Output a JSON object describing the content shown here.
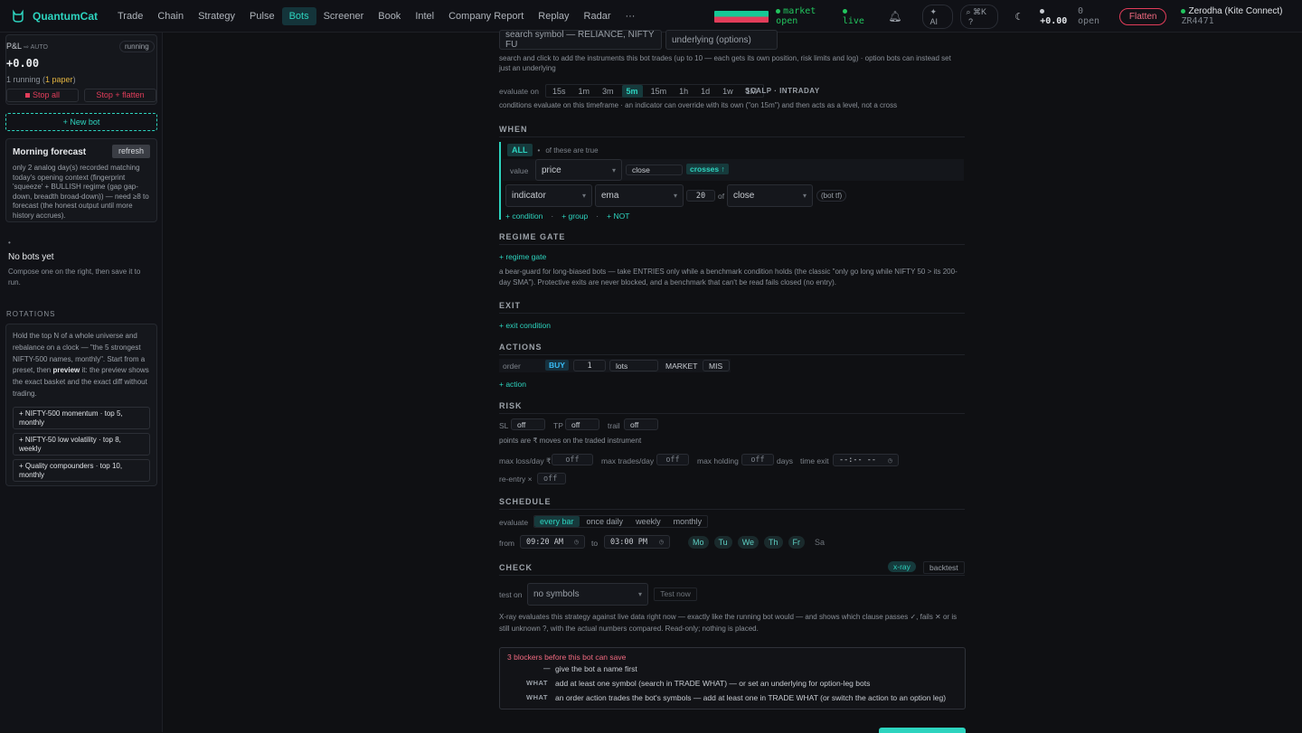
{
  "app": {
    "name": "QuantumCat"
  },
  "nav": [
    "Trade",
    "Chain",
    "Strategy",
    "Pulse",
    "Bots",
    "Screener",
    "Book",
    "Intel",
    "Company Report",
    "Replay",
    "Radar",
    "···"
  ],
  "nav_active": 4,
  "topbar": {
    "market": "market open",
    "live": "live",
    "ai": "AI",
    "kbd": "⌘K",
    "help": "?",
    "pnl": "+0.00",
    "open": "0 open",
    "flatten": "Flatten",
    "broker": "Zerodha (Kite Connect)",
    "account": "ZR4471"
  },
  "sidebar": {
    "pnl_label": "P&L",
    "pnl_sub": "⇨ AUTO",
    "running_badge": "running",
    "pnl_value": "+0.00",
    "running_text": "1 running (",
    "paper_text": "1 paper",
    ")": ")",
    "stop_all": "Stop all",
    "stop_flatten": "Stop + flatten",
    "new_bot": "+ New bot",
    "forecast_title": "Morning forecast",
    "refresh": "refresh",
    "forecast_body": "only 2 analog day(s) recorded matching today's opening context (fingerprint 'squeeze' + BULLISH regime (gap gap-down, breadth broad-down)) — need ≥8 to forecast (the honest output until more history accrues).",
    "bullet": "•",
    "no_bots_title": "No bots yet",
    "no_bots_body": "Compose one on the right, then save it to run.",
    "rotations_label": "ROTATIONS",
    "rotations_body_1": "Hold the top N of a whole universe and rebalance on a clock — \"the 5 strongest NIFTY-500 names, monthly\". Start from a preset, then ",
    "rotations_bold": "preview",
    "rotations_body_2": " it: the preview shows the exact basket and the exact diff without trading.",
    "presets": [
      "+ NIFTY-500 momentum · top 5, monthly",
      "+ NIFTY-50 low volatility · top 8, weekly",
      "+ Quality compounders · top 10, monthly"
    ]
  },
  "main": {
    "symbol_placeholder": "search symbol — RELIANCE, NIFTY FU",
    "underlying_placeholder": "underlying (options)",
    "symbol_help": "search and click to add the instruments this bot trades (up to 10 — each gets its own position, risk limits and log) · option bots can instead set just an underlying",
    "evaluate_on": "evaluate on",
    "timeframes": [
      "15s",
      "1m",
      "3m",
      "5m",
      "15m",
      "1h",
      "1d",
      "1w",
      "1M"
    ],
    "tf_active": 3,
    "scalp": "SCALP · INTRADAY",
    "tf_help": "conditions evaluate on this timeframe · an indicator can override with its own (\"on 15m\") and then acts as a level, not a cross",
    "when": "WHEN",
    "all": "ALL",
    "all_dot": "•",
    "all_text": "of these are true",
    "value": "value",
    "price": "price",
    "close": "close",
    "crosses": "crosses ↑",
    "indicator": "indicator",
    "ema": "ema",
    "period": "20",
    "of": "of",
    "close2": "close",
    "bot_tf": "(bot tf)",
    "add_condition": "+ condition",
    "add_group": "+ group",
    "add_not": "+ NOT",
    "regime": "REGIME GATE",
    "add_regime": "+ regime gate",
    "regime_help": "a bear-guard for long-biased bots — take ENTRIES only while a benchmark condition holds (the classic \"only go long while NIFTY 50 > its 200-day SMA\"). Protective exits are never blocked, and a benchmark that can't be read fails closed (no entry).",
    "exit": "EXIT",
    "add_exit": "+ exit condition",
    "actions": "ACTIONS",
    "order": "order",
    "buy": "BUY",
    "qty": "1",
    "lots": "lots",
    "market": "MARKET",
    "mis": "MIS",
    "add_action": "+ action",
    "risk": "RISK",
    "sl": "SL",
    "tp": "TP",
    "trail": "trail",
    "off": "off",
    "points_help": "points are ₹ moves on the traded instrument",
    "max_loss": "max loss/day ₹",
    "max_trades": "max trades/day",
    "max_holding": "max holding",
    "days": "days",
    "time_exit": "time exit",
    "time_placeholder": "--:-- --",
    "reentry": "re-entry ×",
    "schedule": "SCHEDULE",
    "evaluate": "evaluate",
    "sched_opts": [
      "every bar",
      "once daily",
      "weekly",
      "monthly"
    ],
    "sched_active": 0,
    "from": "from",
    "from_time": "09:20 AM",
    "to": "to",
    "to_time": "03:00 PM",
    "days_list": [
      "Mo",
      "Tu",
      "We",
      "Th",
      "Fr",
      "Sa"
    ],
    "check": "CHECK",
    "xray": "x-ray",
    "backtest": "backtest",
    "test_on": "test on",
    "no_symbols": "no symbols",
    "test_now": "Test now",
    "xray_help": "X-ray evaluates this strategy against live data right now — exactly like the running bot would — and shows which clause passes ✓, fails ✕ or is still unknown ?, with the actual numbers compared. Read-only; nothing is placed.",
    "blockers_title": "3 blockers before this bot can save",
    "blockers": [
      {
        "tag": "—",
        "text": "give the bot a name first"
      },
      {
        "tag": "WHAT",
        "text": "add at least one symbol (search in TRADE WHAT) — or set an underlying for option-leg bots"
      },
      {
        "tag": "WHAT",
        "text": "an order action trades the bot's symbols — add at least one in TRADE WHAT (or switch the action to an option leg)"
      }
    ]
  },
  "colors": {
    "accent": "#2dd4bf",
    "danger": "#e23d5a",
    "bg": "#0f1013"
  }
}
